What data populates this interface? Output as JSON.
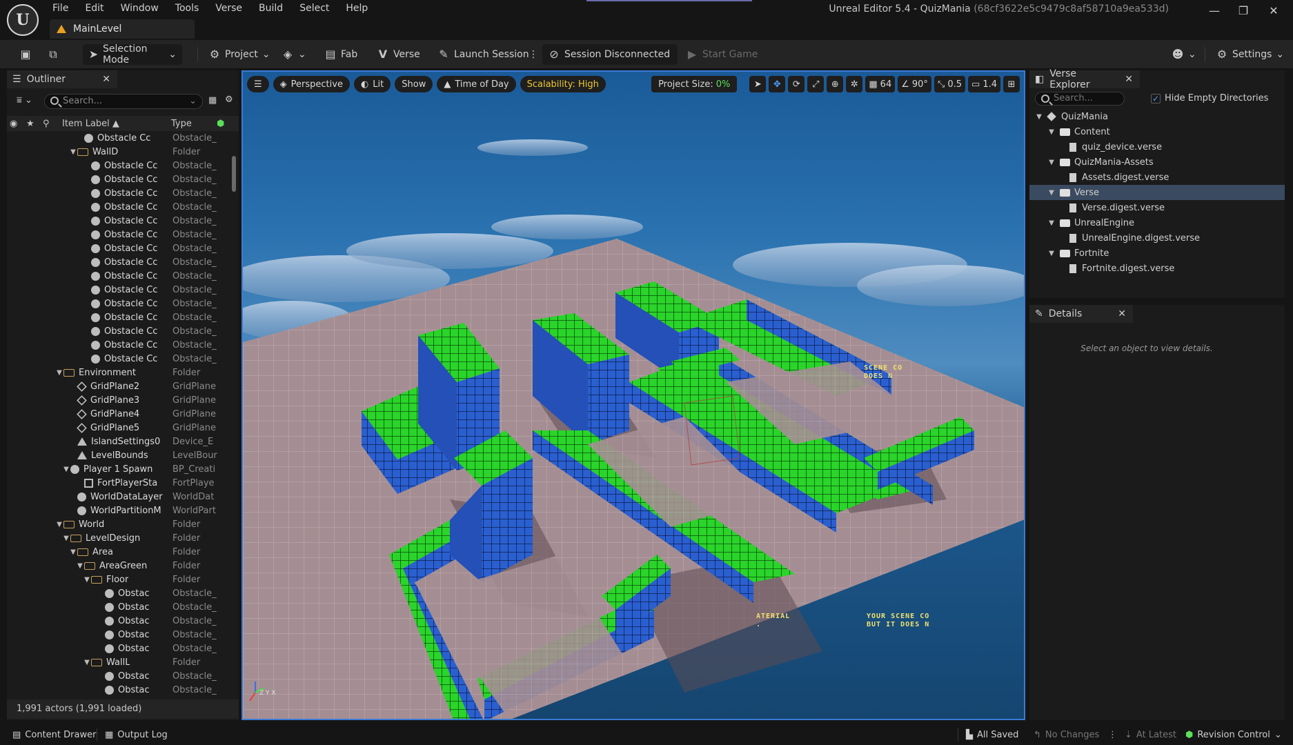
{
  "app": {
    "title": "Unreal Editor 5.4 - QuizMania",
    "hash": "(68cf3622e5c9479c8af58710a9ea533d)",
    "logo_label": "U",
    "level_tab": "MainLevel",
    "menu": [
      "File",
      "Edit",
      "Window",
      "Tools",
      "Verse",
      "Build",
      "Select",
      "Help"
    ],
    "window_controls": {
      "minimize": "—",
      "restore": "❐",
      "close": "✕"
    }
  },
  "toolbar": {
    "selection_mode": "Selection Mode",
    "project": "Project",
    "fab": "Fab",
    "verse": "Verse",
    "launch_session": "Launch Session",
    "session_status": "Session Disconnected",
    "start_game": "Start Game",
    "settings": "Settings"
  },
  "outliner": {
    "tab": "Outliner",
    "search_placeholder": "Search...",
    "col_label": "Item Label ▲",
    "col_type": "Type",
    "footer": "1,991 actors (1,991 loaded)",
    "rows": [
      {
        "indent": 10,
        "kind": "actor",
        "caret": "",
        "name": "Obstacle Cc",
        "type": "Obstacle_"
      },
      {
        "indent": 9,
        "kind": "folder",
        "caret": "▼",
        "name": "WallD",
        "type": "Folder"
      },
      {
        "indent": 11,
        "kind": "actor",
        "caret": "",
        "name": "Obstacle Cc",
        "type": "Obstacle_"
      },
      {
        "indent": 11,
        "kind": "actor",
        "caret": "",
        "name": "Obstacle Cc",
        "type": "Obstacle_"
      },
      {
        "indent": 11,
        "kind": "actor",
        "caret": "",
        "name": "Obstacle Cc",
        "type": "Obstacle_"
      },
      {
        "indent": 11,
        "kind": "actor",
        "caret": "",
        "name": "Obstacle Cc",
        "type": "Obstacle_"
      },
      {
        "indent": 11,
        "kind": "actor",
        "caret": "",
        "name": "Obstacle Cc",
        "type": "Obstacle_"
      },
      {
        "indent": 11,
        "kind": "actor",
        "caret": "",
        "name": "Obstacle Cc",
        "type": "Obstacle_"
      },
      {
        "indent": 11,
        "kind": "actor",
        "caret": "",
        "name": "Obstacle Cc",
        "type": "Obstacle_"
      },
      {
        "indent": 11,
        "kind": "actor",
        "caret": "",
        "name": "Obstacle Cc",
        "type": "Obstacle_"
      },
      {
        "indent": 11,
        "kind": "actor",
        "caret": "",
        "name": "Obstacle Cc",
        "type": "Obstacle_"
      },
      {
        "indent": 11,
        "kind": "actor",
        "caret": "",
        "name": "Obstacle Cc",
        "type": "Obstacle_"
      },
      {
        "indent": 11,
        "kind": "actor",
        "caret": "",
        "name": "Obstacle Cc",
        "type": "Obstacle_"
      },
      {
        "indent": 11,
        "kind": "actor",
        "caret": "",
        "name": "Obstacle Cc",
        "type": "Obstacle_"
      },
      {
        "indent": 11,
        "kind": "actor",
        "caret": "",
        "name": "Obstacle Cc",
        "type": "Obstacle_"
      },
      {
        "indent": 11,
        "kind": "actor",
        "caret": "",
        "name": "Obstacle Cc",
        "type": "Obstacle_"
      },
      {
        "indent": 11,
        "kind": "actor",
        "caret": "",
        "name": "Obstacle Cc",
        "type": "Obstacle_"
      },
      {
        "indent": 7,
        "kind": "folder",
        "caret": "▼",
        "name": "Environment",
        "type": "Folder"
      },
      {
        "indent": 9,
        "kind": "grid",
        "caret": "",
        "name": "GridPlane2",
        "type": "GridPlane"
      },
      {
        "indent": 9,
        "kind": "grid",
        "caret": "",
        "name": "GridPlane3",
        "type": "GridPlane"
      },
      {
        "indent": 9,
        "kind": "grid",
        "caret": "",
        "name": "GridPlane4",
        "type": "GridPlane"
      },
      {
        "indent": 9,
        "kind": "grid",
        "caret": "",
        "name": "GridPlane5",
        "type": "GridPlane"
      },
      {
        "indent": 9,
        "kind": "mtn",
        "caret": "",
        "name": "IslandSettings0",
        "type": "Device_E"
      },
      {
        "indent": 9,
        "kind": "mtn",
        "caret": "",
        "name": "LevelBounds",
        "type": "LevelBour"
      },
      {
        "indent": 8,
        "kind": "actor",
        "caret": "▼",
        "name": "Player 1 Spawn",
        "type": "BP_Creati"
      },
      {
        "indent": 10,
        "kind": "sq",
        "caret": "",
        "name": "FortPlayerSta",
        "type": "FortPlaye"
      },
      {
        "indent": 9,
        "kind": "actor",
        "caret": "",
        "name": "WorldDataLayer",
        "type": "WorldDat"
      },
      {
        "indent": 9,
        "kind": "actor",
        "caret": "",
        "name": "WorldPartitionM",
        "type": "WorldPart"
      },
      {
        "indent": 7,
        "kind": "folder",
        "caret": "▼",
        "name": "World",
        "type": "Folder"
      },
      {
        "indent": 8,
        "kind": "folder",
        "caret": "▼",
        "name": "LevelDesign",
        "type": "Folder"
      },
      {
        "indent": 9,
        "kind": "folder",
        "caret": "▼",
        "name": "Area",
        "type": "Folder"
      },
      {
        "indent": 10,
        "kind": "folder",
        "caret": "▼",
        "name": "AreaGreen",
        "type": "Folder"
      },
      {
        "indent": 11,
        "kind": "folder",
        "caret": "▼",
        "name": "Floor",
        "type": "Folder"
      },
      {
        "indent": 13,
        "kind": "actor",
        "caret": "",
        "name": "Obstac",
        "type": "Obstacle_"
      },
      {
        "indent": 13,
        "kind": "actor",
        "caret": "",
        "name": "Obstac",
        "type": "Obstacle_"
      },
      {
        "indent": 13,
        "kind": "actor",
        "caret": "",
        "name": "Obstac",
        "type": "Obstacle_"
      },
      {
        "indent": 13,
        "kind": "actor",
        "caret": "",
        "name": "Obstac",
        "type": "Obstacle_"
      },
      {
        "indent": 13,
        "kind": "actor",
        "caret": "",
        "name": "Obstac",
        "type": "Obstacle_"
      },
      {
        "indent": 11,
        "kind": "folder",
        "caret": "▼",
        "name": "WallL",
        "type": "Folder"
      },
      {
        "indent": 13,
        "kind": "actor",
        "caret": "",
        "name": "Obstac",
        "type": "Obstacle_"
      },
      {
        "indent": 13,
        "kind": "actor",
        "caret": "",
        "name": "Obstac",
        "type": "Obstacle_"
      }
    ]
  },
  "viewport": {
    "perspective": "Perspective",
    "lit": "Lit",
    "show": "Show",
    "time_of_day": "Time of Day",
    "scalability": "Scalability: High",
    "project_size_label": "Project Size:",
    "project_size_value": "0%",
    "grid_snap": "64",
    "rotation_snap": "90°",
    "scale_snap": "0.5",
    "camera_speed": "1.4",
    "overlay_1": "SCENE CO\nDOES N",
    "overlay_2": "ATERIAL\n.",
    "overlay_3": "YOUR SCENE CO\nBUT IT DOES N",
    "axis_labels": [
      "Z",
      "Y",
      "X"
    ]
  },
  "verse_explorer": {
    "tab": "Verse Explorer",
    "search_placeholder": "Search...",
    "hide_empty": "Hide Empty Directories",
    "tree": [
      {
        "indent": 0,
        "kind": "root",
        "caret": "▼",
        "label": "QuizMania",
        "selected": false
      },
      {
        "indent": 1,
        "kind": "folder",
        "caret": "▼",
        "label": "Content",
        "selected": false
      },
      {
        "indent": 2,
        "kind": "file",
        "caret": "",
        "label": "quiz_device.verse",
        "selected": false
      },
      {
        "indent": 1,
        "kind": "folder",
        "caret": "▼",
        "label": "QuizMania-Assets",
        "selected": false
      },
      {
        "indent": 2,
        "kind": "file",
        "caret": "",
        "label": "Assets.digest.verse",
        "selected": false
      },
      {
        "indent": 1,
        "kind": "folder",
        "caret": "▼",
        "label": "Verse",
        "selected": true
      },
      {
        "indent": 2,
        "kind": "file",
        "caret": "",
        "label": "Verse.digest.verse",
        "selected": false
      },
      {
        "indent": 1,
        "kind": "folder",
        "caret": "▼",
        "label": "UnrealEngine",
        "selected": false
      },
      {
        "indent": 2,
        "kind": "file",
        "caret": "",
        "label": "UnrealEngine.digest.verse",
        "selected": false
      },
      {
        "indent": 1,
        "kind": "folder",
        "caret": "▼",
        "label": "Fortnite",
        "selected": false
      },
      {
        "indent": 2,
        "kind": "file",
        "caret": "",
        "label": "Fortnite.digest.verse",
        "selected": false
      }
    ]
  },
  "details": {
    "tab": "Details",
    "empty": "Select an object to view details."
  },
  "statusbar": {
    "content_drawer": "Content Drawer",
    "output_log": "Output Log",
    "all_saved": "All Saved",
    "no_changes": "No Changes",
    "at_latest": "At Latest",
    "revision_control": "Revision Control"
  },
  "colors": {
    "accent_blue": "#3a7bd5",
    "scalability_yellow": "#f0c830",
    "project_size_green": "#5be05b",
    "wall_blue": "#2456c8",
    "wall_green": "#22d422"
  }
}
